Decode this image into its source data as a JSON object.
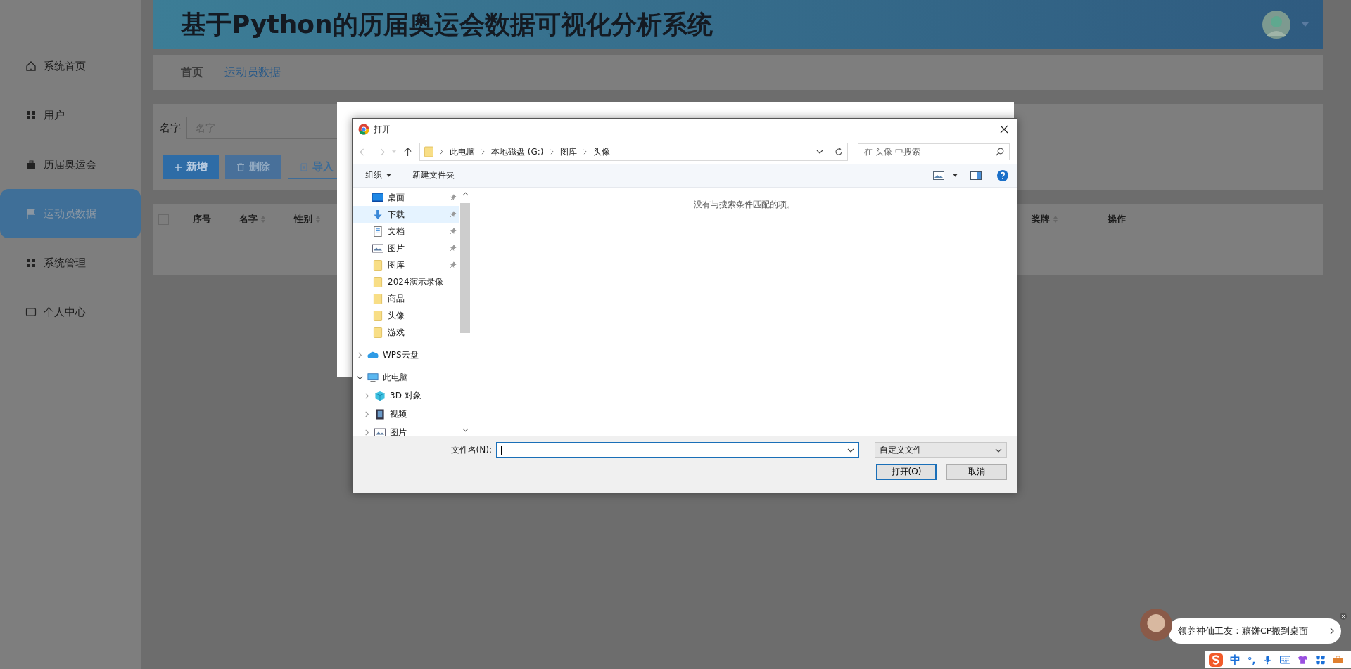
{
  "sidebar": {
    "items": [
      {
        "label": "系统首页",
        "selected": false
      },
      {
        "label": "用户",
        "selected": false
      },
      {
        "label": "历届奥运会",
        "selected": false
      },
      {
        "label": "运动员数据",
        "selected": true
      },
      {
        "label": "系统管理",
        "selected": false
      },
      {
        "label": "个人中心",
        "selected": false
      }
    ]
  },
  "header": {
    "title": "基于Python的历届奥运会数据可视化分析系统"
  },
  "breadcrumb": [
    {
      "label": "首页",
      "selected": false
    },
    {
      "label": "运动员数据",
      "selected": true
    }
  ],
  "search": {
    "label": "名字",
    "placeholder": "名字"
  },
  "actions": [
    {
      "label": "新增",
      "kind": "primary"
    },
    {
      "label": "删除",
      "kind": "danger"
    },
    {
      "label": "导入",
      "kind": "outline"
    }
  ],
  "table": {
    "select_all": {
      "checked": false
    },
    "columns": [
      {
        "label": "序号",
        "sortable": false
      },
      {
        "label": "名字",
        "sortable": true
      },
      {
        "label": "性别",
        "sortable": true
      },
      {
        "label": "奖牌",
        "sortable": true
      },
      {
        "label": "操作",
        "sortable": false
      }
    ]
  },
  "dialog": {
    "title": "打开",
    "path": [
      "此电脑",
      "本地磁盘 (G:)",
      "图库",
      "头像"
    ],
    "search_placeholder": "在 头像 中搜索",
    "toolbar": [
      "组织",
      "新建文件夹"
    ],
    "nav": [
      {
        "label": "桌面",
        "kind": "desktop",
        "pinned": true,
        "hovered": false
      },
      {
        "label": "下载",
        "kind": "download",
        "pinned": true,
        "hovered": true
      },
      {
        "label": "文档",
        "kind": "document",
        "pinned": true,
        "hovered": false
      },
      {
        "label": "图片",
        "kind": "pictures",
        "pinned": true,
        "hovered": false
      },
      {
        "label": "图库",
        "kind": "folder",
        "pinned": true,
        "hovered": false
      },
      {
        "label": "2024演示录像",
        "kind": "folder",
        "pinned": false,
        "hovered": false
      },
      {
        "label": "商品",
        "kind": "folder",
        "pinned": false,
        "hovered": false
      },
      {
        "label": "头像",
        "kind": "folder",
        "pinned": false,
        "hovered": false
      },
      {
        "label": "游戏",
        "kind": "folder",
        "pinned": false,
        "hovered": false
      }
    ],
    "tree": [
      {
        "label": "WPS云盘",
        "kind": "cloud",
        "expanded": false
      },
      {
        "label": "此电脑",
        "kind": "computer",
        "expanded": true,
        "children": [
          {
            "label": "3D 对象",
            "kind": "cube",
            "expanded": false
          },
          {
            "label": "视频",
            "kind": "video",
            "expanded": false
          },
          {
            "label": "图片",
            "kind": "pictures",
            "expanded": false
          }
        ]
      }
    ],
    "empty_message": "没有与搜索条件匹配的项。",
    "filename_label": "文件名(N):",
    "filetype": "自定义文件",
    "buttons": [
      {
        "label": "打开(O)",
        "kind": "default"
      },
      {
        "label": "取消",
        "kind": "normal"
      }
    ]
  },
  "notification": {
    "text": "领养神仙工友：藕饼CP搬到桌面"
  },
  "ime": {
    "mode": "中",
    "punct": "°,"
  }
}
